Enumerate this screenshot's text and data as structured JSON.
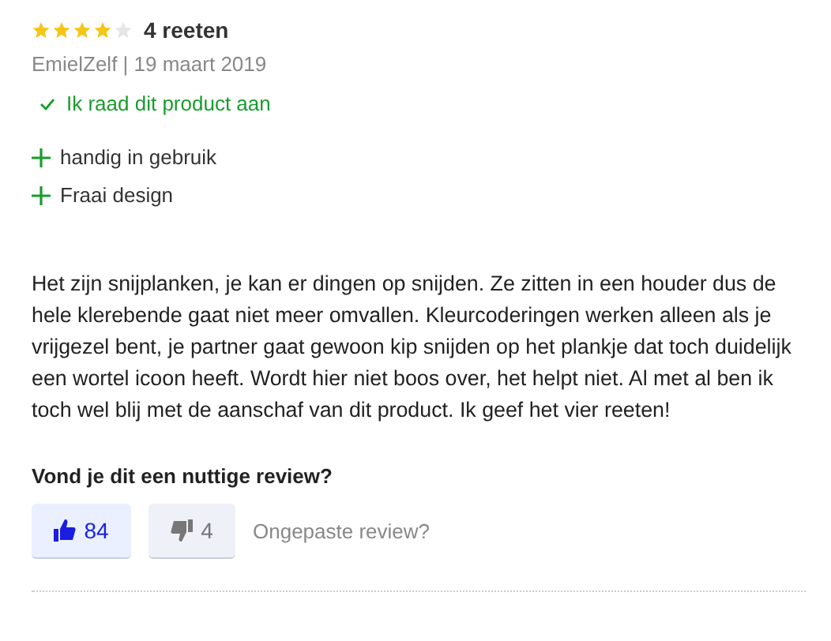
{
  "rating": {
    "stars": 4,
    "label": "4 reeten"
  },
  "meta": "EmielZelf | 19 maart 2019",
  "recommend": {
    "on": true,
    "label": "Ik raad dit product aan"
  },
  "pros": [
    "handig in gebruik",
    "Fraai design"
  ],
  "body": "Het zijn snijplanken, je kan er dingen op snijden. Ze zitten in een houder dus de hele klerebende gaat niet meer omvallen. Kleurcoderingen werken alleen als je vrijgezel bent, je partner gaat gewoon kip snijden op het plankje dat toch duidelijk een wortel icoon heeft. Wordt hier niet boos over, het helpt niet. Al met al ben ik toch wel blij met de aanschaf van dit product. Ik geef het vier reeten!",
  "question": "Vond je dit een nuttige review?",
  "votes": [
    {
      "kind": "up",
      "count": "84",
      "selected": true
    },
    {
      "kind": "down",
      "count": "4",
      "selected": false
    }
  ],
  "report": "Ongepaste review?"
}
